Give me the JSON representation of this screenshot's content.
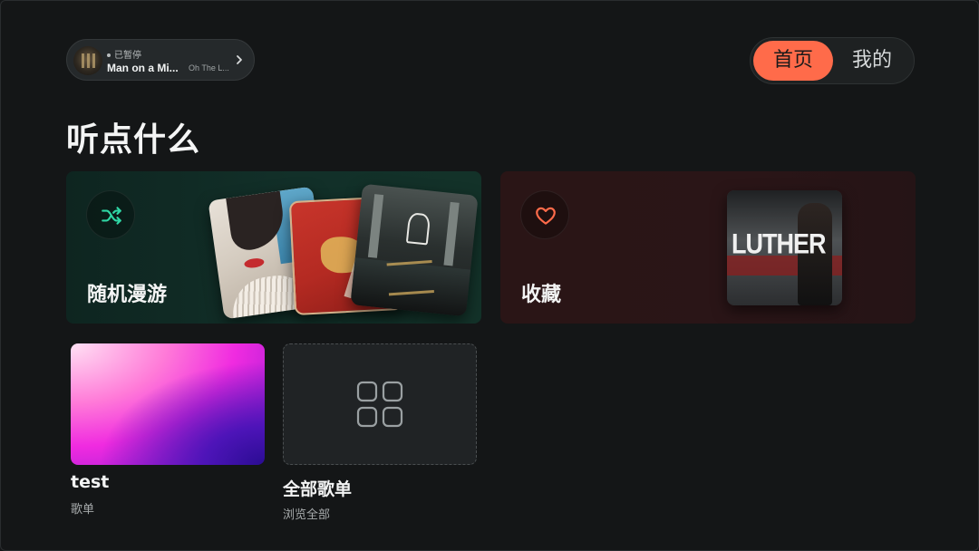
{
  "now_playing": {
    "status": "已暂停",
    "title": "Man on a Mi...",
    "artist": "Oh The L..."
  },
  "tabs": [
    {
      "label": "首页",
      "active": true
    },
    {
      "label": "我的",
      "active": false
    }
  ],
  "section_title": "听点什么",
  "cards": {
    "random": {
      "label": "随机漫游",
      "icon": "shuffle-icon"
    },
    "favorites": {
      "label": "收藏",
      "icon": "heart-icon"
    }
  },
  "playlists": [
    {
      "title": "test",
      "subtitle": "歌单"
    },
    {
      "title": "全部歌单",
      "subtitle": "浏览全部",
      "icon": "grid-icon"
    }
  ],
  "colors": {
    "accent": "#ff6b4a",
    "background": "#141617",
    "shuffle_icon": "#2fd6a4",
    "heart_icon": "#ff6b4a"
  }
}
